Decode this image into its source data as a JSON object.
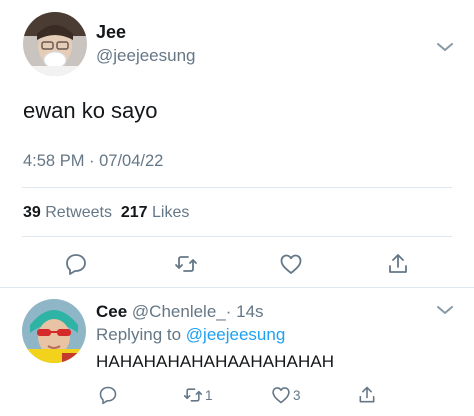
{
  "tweet": {
    "author_name": "Jee",
    "author_handle": "@jeejeesung",
    "text": "ewan ko sayo",
    "timestamp": "4:58 PM · 07/04/22",
    "retweets_count": "39",
    "retweets_label": "Retweets",
    "likes_count": "217",
    "likes_label": "Likes",
    "avatar_icon": "profile-photo-icon",
    "menu_icon": "chevron-down-icon",
    "actions": [
      "reply-icon",
      "retweet-icon",
      "like-icon",
      "share-icon"
    ]
  },
  "reply": {
    "author_name": "Cee",
    "author_handle": "@Chenlele_",
    "age": "· 14s",
    "replying_to_label": "Replying to",
    "replying_to_handle": "@jeejeesung",
    "text": "HAHAHAHAHAHAAHAHAHAH",
    "retweet_count": "1",
    "like_count": "3",
    "avatar_icon": "profile-photo-icon",
    "menu_icon": "chevron-down-icon"
  },
  "colors": {
    "text_primary": "#14171a",
    "text_secondary": "#657786",
    "link": "#1da1f2",
    "divider": "#e1e8ed"
  }
}
